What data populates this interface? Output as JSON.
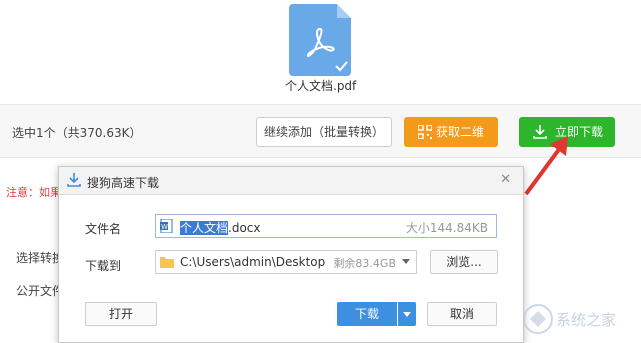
{
  "file": {
    "name": "个人文档.pdf"
  },
  "action_bar": {
    "selected_info": "选中1个（共370.63K）",
    "continue_label": "继续添加（批量转换）",
    "qr_label": "获取二维",
    "download_label": "立即下载"
  },
  "background": {
    "notice": "注意：如果",
    "label_1": "选择转换",
    "label_2": "公开文件"
  },
  "dialog": {
    "title": "搜狗高速下载",
    "filename_label": "文件名",
    "filename_selected": "个人文档",
    "filename_ext": ".docx",
    "size_text": "大小144.84KB",
    "saveto_label": "下载到",
    "path": "C:\\Users\\admin\\Desktop",
    "free_space": "剩余83.4GB",
    "browse_label": "浏览...",
    "open_label": "打开",
    "download_label": "下载",
    "cancel_label": "取消"
  },
  "watermark": {
    "text": "系统之家"
  },
  "colors": {
    "qr_button": "#f39a1b",
    "download_button": "#2db52b",
    "dialog_download": "#3d8fe0",
    "arrow": "#e0382f"
  }
}
